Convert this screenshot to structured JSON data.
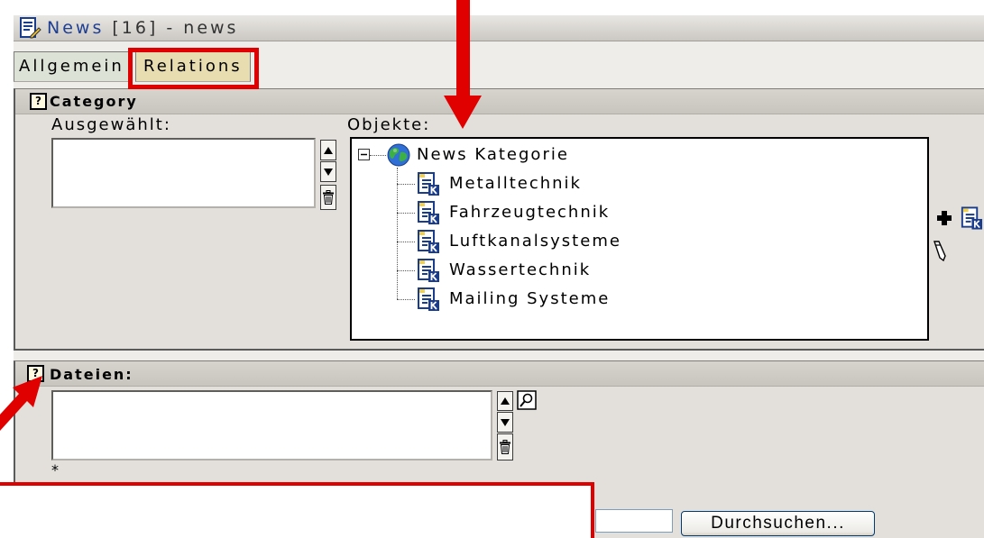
{
  "header": {
    "title_link": "News",
    "title_rest": "[16] - news",
    "icon": "record-edit-icon"
  },
  "tabs": [
    {
      "label": "Allgemein",
      "active": false
    },
    {
      "label": "Relations",
      "active": true
    }
  ],
  "category": {
    "title": "Category",
    "selected_label": "Ausgewählt:",
    "objects_label": "Objekte:",
    "tree": {
      "root": "News Kategorie",
      "root_icon": "globe-icon",
      "child_icon": "record-icon",
      "children": [
        "Metalltechnik",
        "Fahrzeugtechnik",
        "Luftkanalsysteme",
        "Wassertechnik",
        "Mailing Systeme"
      ]
    }
  },
  "files": {
    "title": "Dateien:",
    "required_marker": "*",
    "browse_button": "Durchsuchen..."
  },
  "icons": {
    "help": "help-icon",
    "help_glyph": "?",
    "move_up": "arrow-up-icon",
    "move_down": "arrow-down-icon",
    "remove": "trash-icon",
    "add_record": "plus-icon",
    "wizard": "wand-icon",
    "browse_files": "browse-icon",
    "collapse": "minus-box-icon"
  },
  "colors": {
    "annotation_red": "#e00000",
    "tab_active": "#e8ddb0",
    "tab_inactive": "#dde2d6",
    "link": "#1f3f93"
  }
}
